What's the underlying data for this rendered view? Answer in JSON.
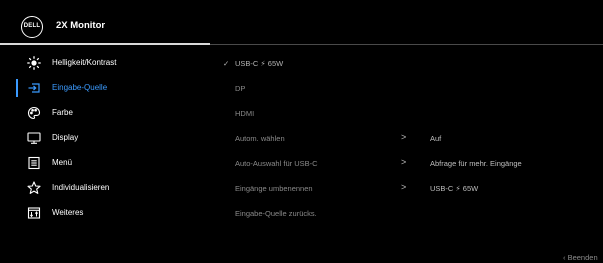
{
  "header": {
    "logo_text": "DELL",
    "title": "2X Monitor"
  },
  "sidebar": {
    "items": [
      {
        "label": "Helligkeit/Kontrast",
        "icon": "brightness-icon"
      },
      {
        "label": "Eingabe-Quelle",
        "icon": "input-source-icon",
        "active": true
      },
      {
        "label": "Farbe",
        "icon": "color-palette-icon"
      },
      {
        "label": "Display",
        "icon": "display-icon"
      },
      {
        "label": "Menü",
        "icon": "menu-icon"
      },
      {
        "label": "Individualisieren",
        "icon": "star-icon"
      },
      {
        "label": "Weiteres",
        "icon": "others-icon"
      }
    ]
  },
  "options": [
    {
      "label": "USB-C ⚡ 65W",
      "selected": true
    },
    {
      "label": "DP"
    },
    {
      "label": "HDMI"
    },
    {
      "label": "Autom. wählen",
      "value": "Auf"
    },
    {
      "label": "Auto-Auswahl für USB-C",
      "value": "Abfrage für mehr. Eingänge"
    },
    {
      "label": "Eingänge umbenennen",
      "value": "USB-C ⚡ 65W"
    },
    {
      "label": "Eingabe-Quelle zurücks."
    }
  ],
  "chevron_glyph": ">",
  "check_glyph": "✓",
  "footer": {
    "exit_label": "‹ Beenden"
  },
  "colors": {
    "accent": "#3b9bff",
    "background": "#000000",
    "text": "#ffffff",
    "dim_text": "#8a8a8a"
  }
}
